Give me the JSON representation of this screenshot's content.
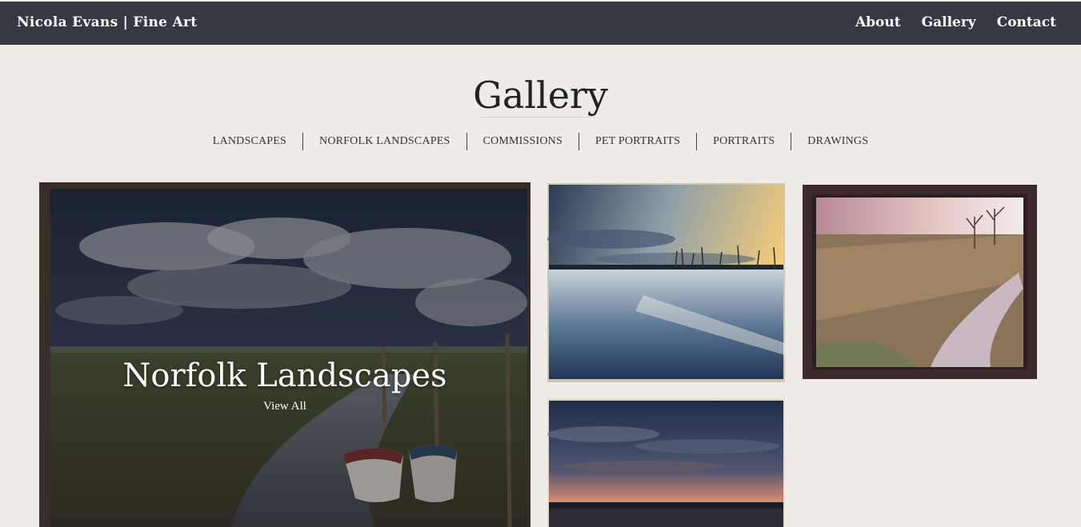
{
  "header": {
    "brand": "Nicola Evans | Fine Art",
    "nav": [
      "About",
      "Gallery",
      "Contact"
    ]
  },
  "page": {
    "title": "Gallery",
    "categories": [
      "LANDSCAPES",
      "NORFOLK LANDSCAPES",
      "COMMISSIONS",
      "PET PORTRAITS",
      "PORTRAITS",
      "DRAWINGS"
    ]
  },
  "feature": {
    "title": "Norfolk Landscapes",
    "link": "View All"
  },
  "colors": {
    "header_bg": "#353a42",
    "page_bg": "#efece8"
  }
}
